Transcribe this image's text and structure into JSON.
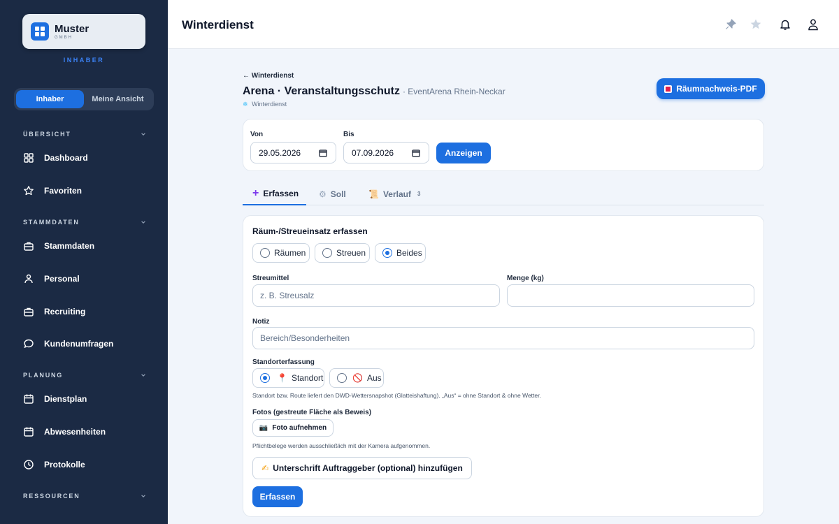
{
  "brand": {
    "name": "Muster",
    "sub": "GMBH",
    "role": "INHABER"
  },
  "view_toggle": {
    "owner": "Inhaber",
    "mine": "Meine Ansicht"
  },
  "sidebar": {
    "sections": {
      "overview": "ÜBERSICHT",
      "master": "STAMMDATEN",
      "planning": "PLANUNG",
      "resources": "RESSOURCEN"
    },
    "items": {
      "dashboard": "Dashboard",
      "favorites": "Favoriten",
      "masterdata": "Stammdaten",
      "staff": "Personal",
      "recruiting": "Recruiting",
      "surveys": "Kundenumfragen",
      "schedule": "Dienstplan",
      "absences": "Abwesenheiten",
      "logs": "Protokolle"
    }
  },
  "header": {
    "title": "Winterdienst"
  },
  "page": {
    "back": "← Winterdienst",
    "title": "Arena · Veranstaltungsschutz",
    "subtitle": "· EventArena Rhein-Neckar",
    "tag_icon": "❄",
    "tag": "Winterdienst",
    "pdf_button": "Räumnachweis-PDF"
  },
  "filter": {
    "from_label": "Von",
    "from_value": "29.05.2026",
    "to_label": "Bis",
    "to_value": "07.09.2026",
    "show_button": "Anzeigen"
  },
  "tabs": {
    "capture_icon": "+",
    "capture": "Erfassen",
    "target_icon": "⚙",
    "target": "Soll",
    "history_icon": "📜",
    "history": "Verlauf",
    "history_count": "3"
  },
  "form": {
    "title": "Räum-/Streueinsatz erfassen",
    "mode_options": {
      "clear": "Räumen",
      "grit": "Streuen",
      "both": "Beides"
    },
    "mode_selected": "Beides",
    "grit_label": "Streumittel",
    "grit_placeholder": "z. B. Streusalz",
    "amount_label": "Menge (kg)",
    "amount_value": "",
    "note_label": "Notiz",
    "note_placeholder": "Bereich/Besonderheiten",
    "location_label": "Standorterfassung",
    "location_on_icon": "📍",
    "location_on": "Standort",
    "location_off_icon": "🚫",
    "location_off": "Aus",
    "location_hint": "Standort bzw. Route liefert den DWD-Wettersnapshot (Glatteishaftung). „Aus“ = ohne Standort & ohne Wetter.",
    "photos_label": "Fotos (gestreute Fläche als Beweis)",
    "photo_button_icon": "📷",
    "photo_button": "Foto aufnehmen",
    "photo_hint": "Pflichtbelege werden ausschließlich mit der Kamera aufgenommen.",
    "signature_icon": "✍",
    "signature_button": "Unterschrift Auftraggeber (optional) hinzufügen",
    "submit": "Erfassen"
  },
  "colors": {
    "primary": "#1d6fe0",
    "sidebar": "#1b2a44",
    "page_bg": "#f1f5fb"
  }
}
